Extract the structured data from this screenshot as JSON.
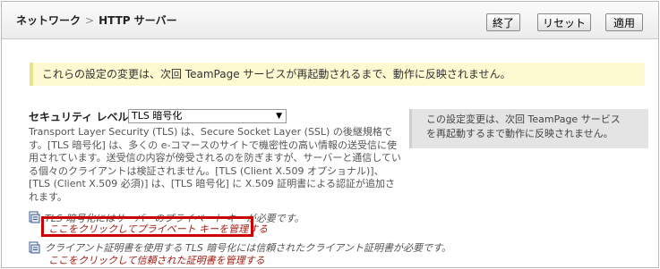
{
  "breadcrumb": {
    "parent": "ネットワーク",
    "separator": ">",
    "current": "HTTP サーバー"
  },
  "toolbar": {
    "done_label": "終了",
    "reset_label": "リセット",
    "apply_label": "適用"
  },
  "notice": {
    "text": "これらの設定の変更は、次回 TeamPage サービスが再起動されるまで、動作に反映されません。"
  },
  "security": {
    "label": "セキュリティ レベル",
    "selected": "TLS 暗号化",
    "description": "Transport Layer Security (TLS) は、Secure Socket Layer (SSL) の後継規格です。[TLS 暗号化] は、多くの e-コマースのサイトで機密性の高い情報の送受信に使用されています。送受信の内容が傍受されるのを防ぎますが、サーバーと通信している個々のクライアントは検証されません。[TLS (Client X.509 オプショナル)]、[TLS (Client X.509 必須)] は、[TLS 暗号化] に X.509 証明書による認証が追加されます。",
    "restart_note_line1": "この設定変更は、次回 TeamPage サービス",
    "restart_note_line2": "を再起動するまで動作に反映されません。"
  },
  "requirements": [
    {
      "icon": "document-icon",
      "text": "TLS 暗号化にはサーバーのプライベート キーが必要です。",
      "link": "ここをクリックしてプライベート キーを管理する"
    },
    {
      "icon": "document-icon",
      "text": "クライアント証明書を使用する TLS 暗号化には信頼されたクライアント証明書が必要です。",
      "link": "ここをクリックして信頼された証明書を管理する"
    }
  ],
  "colors": {
    "notice_bg": "#fdf9d0",
    "link": "#9b1a0e",
    "highlight": "#cc0000"
  }
}
